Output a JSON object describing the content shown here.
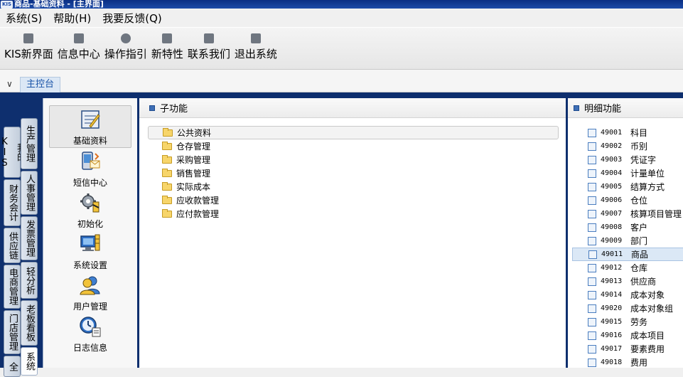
{
  "window": {
    "title": "商品-基础资料 - [主界面]",
    "logo_text": "KIS"
  },
  "menubar": {
    "items": [
      "系统(S)",
      "帮助(H)",
      "我要反馈(Q)"
    ]
  },
  "toolbar": {
    "items": [
      {
        "label": "KIS新界面",
        "icon": "layout-icon"
      },
      {
        "label": "信息中心",
        "icon": "mail-icon"
      },
      {
        "label": "操作指引",
        "icon": "compass-icon"
      },
      {
        "label": "新特性",
        "icon": "star-icon"
      },
      {
        "label": "联系我们",
        "icon": "chat-icon"
      },
      {
        "label": "退出系统",
        "icon": "exit-icon"
      }
    ]
  },
  "tabs": {
    "chevron": "∨",
    "active": "主控台"
  },
  "sidebar": {
    "vtabs_outer": [
      "我的KIS",
      "财务会计",
      "供应链",
      "电商管理",
      "门店管理",
      "全"
    ],
    "vtabs_inner": [
      "生产管理",
      "人事管理",
      "发票管理",
      "轻分析",
      "老板看板",
      "系统"
    ]
  },
  "iconpanel": {
    "items": [
      {
        "label": "基础资料",
        "icon": "base-data-icon"
      },
      {
        "label": "短信中心",
        "icon": "sms-icon"
      },
      {
        "label": "初始化",
        "icon": "init-gear-icon"
      },
      {
        "label": "系统设置",
        "icon": "monitor-settings-icon"
      },
      {
        "label": "用户管理",
        "icon": "users-icon"
      },
      {
        "label": "日志信息",
        "icon": "log-clock-icon"
      }
    ]
  },
  "subfunctions": {
    "title": "子功能",
    "items": [
      "公共资料",
      "仓存管理",
      "采购管理",
      "销售管理",
      "实际成本",
      "应收款管理",
      "应付款管理"
    ]
  },
  "details": {
    "title": "明细功能",
    "items": [
      {
        "code": "49001",
        "name": "科目"
      },
      {
        "code": "49002",
        "name": "币别"
      },
      {
        "code": "49003",
        "name": "凭证字"
      },
      {
        "code": "49004",
        "name": "计量单位"
      },
      {
        "code": "49005",
        "name": "结算方式"
      },
      {
        "code": "49006",
        "name": "仓位"
      },
      {
        "code": "49007",
        "name": "核算项目管理"
      },
      {
        "code": "49008",
        "name": "客户"
      },
      {
        "code": "49009",
        "name": "部门"
      },
      {
        "code": "49011",
        "name": "商品"
      },
      {
        "code": "49012",
        "name": "仓库"
      },
      {
        "code": "49013",
        "name": "供应商"
      },
      {
        "code": "49014",
        "name": "成本对象"
      },
      {
        "code": "49020",
        "name": "成本对象组"
      },
      {
        "code": "49015",
        "name": "劳务"
      },
      {
        "code": "49016",
        "name": "成本项目"
      },
      {
        "code": "49017",
        "name": "要素费用"
      },
      {
        "code": "49018",
        "name": "费用"
      }
    ]
  }
}
